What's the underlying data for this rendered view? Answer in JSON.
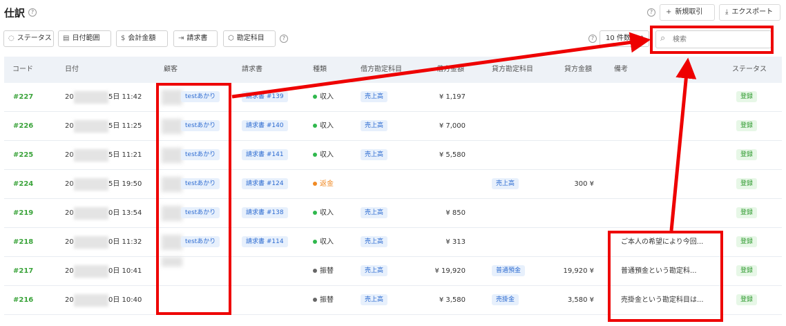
{
  "header": {
    "title": "仕訳",
    "help": "?",
    "new_entry": "新規取引",
    "new_entry_icon": "+",
    "export": "エクスポート",
    "export_icon": "⤓"
  },
  "filters": {
    "status": "ステータス",
    "date_range": "日付範囲",
    "total_amount": "会計金額",
    "invoice": "請求書",
    "account": "勘定科目",
    "page_size": "10 件数",
    "search_placeholder": "検索"
  },
  "columns": {
    "code": "コード",
    "date": "日付",
    "customer": "顧客",
    "invoice": "請求書",
    "kind": "種類",
    "debit_account": "借方勘定科目",
    "debit_amount": "借方金額",
    "credit_account": "貸方勘定科目",
    "credit_amount": "貸方金額",
    "note": "備考",
    "status": "ステータス"
  },
  "rows": [
    {
      "code": "#227",
      "date_prefix": "20",
      "date_suffix": "5日 11:42",
      "customer": "testあかり",
      "invoice": "請求書 #139",
      "kind": "収入",
      "debit_account": "売上高",
      "debit_amount": "¥ 1,197",
      "credit_account": "",
      "credit_amount": "",
      "note": "",
      "status": "登録"
    },
    {
      "code": "#226",
      "date_prefix": "20",
      "date_suffix": "5日 11:25",
      "customer": "testあかり",
      "invoice": "請求書 #140",
      "kind": "収入",
      "debit_account": "売上高",
      "debit_amount": "¥ 7,000",
      "credit_account": "",
      "credit_amount": "",
      "note": "",
      "status": "登録"
    },
    {
      "code": "#225",
      "date_prefix": "20",
      "date_suffix": "5日 11:21",
      "customer": "testあかり",
      "invoice": "請求書 #141",
      "kind": "収入",
      "debit_account": "売上高",
      "debit_amount": "¥ 5,580",
      "credit_account": "",
      "credit_amount": "",
      "note": "",
      "status": "登録"
    },
    {
      "code": "#224",
      "date_prefix": "20",
      "date_suffix": "5日 19:50",
      "customer": "testあかり",
      "invoice": "請求書 #124",
      "kind": "返金",
      "debit_account": "",
      "debit_amount": "",
      "credit_account": "売上高",
      "credit_amount": "300 ¥",
      "note": "",
      "status": "登録"
    },
    {
      "code": "#219",
      "date_prefix": "20",
      "date_suffix": "0日 13:54",
      "customer": "testあかり",
      "invoice": "請求書 #138",
      "kind": "収入",
      "debit_account": "売上高",
      "debit_amount": "¥ 850",
      "credit_account": "",
      "credit_amount": "",
      "note": "",
      "status": "登録"
    },
    {
      "code": "#218",
      "date_prefix": "20",
      "date_suffix": "0日 11:32",
      "customer": "testあかり",
      "invoice": "請求書 #114",
      "kind": "収入",
      "debit_account": "売上高",
      "debit_amount": "¥ 313",
      "credit_account": "",
      "credit_amount": "",
      "note": "ご本人の希望により今回...",
      "status": "登録"
    },
    {
      "code": "#217",
      "date_prefix": "20",
      "date_suffix": "0日 10:41",
      "customer": "",
      "invoice": "",
      "kind": "振替",
      "debit_account": "売上高",
      "debit_amount": "¥ 19,920",
      "credit_account": "普通預金",
      "credit_amount": "19,920 ¥",
      "note": "普通預金という勘定科...",
      "status": "登録"
    },
    {
      "code": "#216",
      "date_prefix": "20",
      "date_suffix": "0日 10:40",
      "customer": "",
      "invoice": "",
      "kind": "振替",
      "debit_account": "売上高",
      "debit_amount": "¥ 3,580",
      "credit_account": "売掛金",
      "credit_amount": "3,580 ¥",
      "note": "売掛金という勘定科目は...",
      "status": "登録"
    }
  ],
  "colors": {
    "income": "#2fb84d",
    "refund": "#f08a24",
    "transfer": "#666666",
    "annotation": "#ee0000"
  }
}
